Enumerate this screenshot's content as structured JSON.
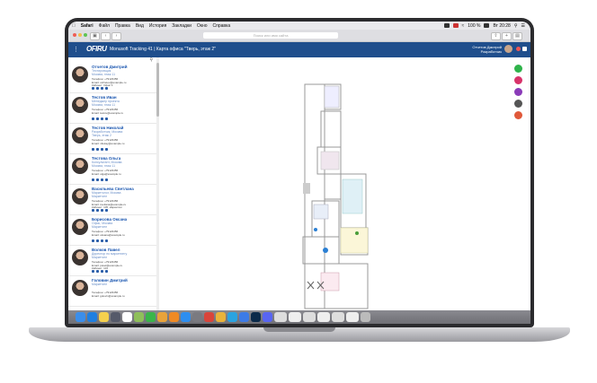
{
  "menubar": {
    "items": [
      "Safari",
      "Файл",
      "Правка",
      "Вид",
      "История",
      "Закладки",
      "Окно",
      "Справка"
    ],
    "battery": "100 %",
    "clock": "Вт 20:28"
  },
  "browser": {
    "url_placeholder": "Поиск или имя сайта"
  },
  "app": {
    "logo": "OFIRU",
    "title": "Monusoft Tracking 41 | Карта офиса \"Тверь, этаж 2\"",
    "user_name": "Отчетов Дмитрий",
    "user_sub": "Разработчик"
  },
  "people": [
    {
      "name": "Отчетов Дмитрий",
      "role": "Тестировщик",
      "location": "Москва, этаж 11",
      "phone": "Телефон: +79123456",
      "email": "Email: otchetov@example.ru",
      "room": "Кабинет: Офис 1"
    },
    {
      "name": "Тестов Иван",
      "role": "Менеджер проекта",
      "location": "Москва, этаж 11",
      "phone": "Телефон: +79123456",
      "email": "Email: testov@example.ru",
      "room": ""
    },
    {
      "name": "Тестов Николай",
      "role": "Разработчик, Москва",
      "location": "Тверь, этаж 2",
      "phone": "Телефон: +79123456",
      "email": "Email: nikolay@example.ru",
      "room": ""
    },
    {
      "name": "Тестова Ольга",
      "role": "Консультант, Москва",
      "location": "Москва, этаж 11",
      "phone": "Телефон: +79123456",
      "email": "Email: olga@example.ru",
      "room": ""
    },
    {
      "name": "Васильева Светлана",
      "role": "Маркетолог, Москва",
      "location": "Маркетинг",
      "phone": "Телефон: +79123456",
      "email": "Email: svetlana@example.ru",
      "room": "Кабинет: 105, маркетинг"
    },
    {
      "name": "Борисова Оксана",
      "role": "Офис, Москва",
      "location": "Маркетинг",
      "phone": "Телефон: +79123456",
      "email": "Email: oksana@example.ru",
      "room": ""
    },
    {
      "name": "Волков Павел",
      "role": "Директор по маркетингу",
      "location": "Маркетинг",
      "phone": "Телефон: +79123456",
      "email": "Email: pavel@example.ru",
      "room": "Кабинет: 101"
    },
    {
      "name": "Головин Дмитрий",
      "role": "Маркетинг",
      "location": "",
      "phone": "Телефон: +79123456",
      "email": "Email: golovin@example.ru",
      "room": ""
    }
  ],
  "colors": {
    "header": "#1f4e8c",
    "link": "#1a56b0",
    "fab_zoom": "#2fb34a",
    "fab_filter": "#d8336a",
    "fab_user": "#8a3bb8",
    "fab_print": "#555555",
    "fab_info": "#e0593a"
  },
  "dock_icons": [
    "finder-icon",
    "safari-icon",
    "notes-icon",
    "launchpad-icon",
    "calendar-icon",
    "photos-icon",
    "facetime-icon",
    "chrome-icon",
    "books-icon",
    "appstore-icon",
    "settings-icon",
    "skype-icon",
    "chrome2-icon",
    "telegram-icon",
    "keynote-icon",
    "photoshop-icon",
    "discord-icon",
    "window1-icon",
    "window2-icon",
    "window3-icon",
    "window4-icon",
    "window5-icon",
    "window6-icon",
    "trash-icon"
  ]
}
